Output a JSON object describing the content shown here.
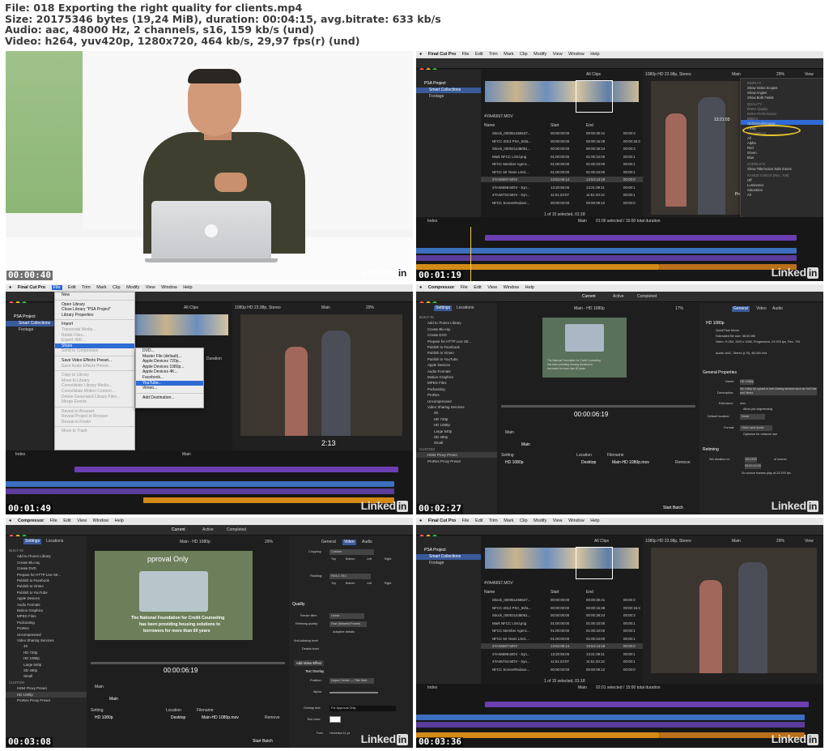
{
  "header": {
    "line1": "File: 018 Exporting the right quality for clients.mp4",
    "line2": "Size: 20175346 bytes (19,24 MiB), duration: 00:04:15, avg.bitrate: 633 kb/s",
    "line3": "Audio: aac, 48000 Hz, 2 channels, s16, 159 kb/s (und)",
    "line4": "Video: h264, yuv420p, 1280x720, 464 kb/s, 29,97 fps(r) (und)"
  },
  "watermark": "Linked",
  "watermark_in": "in",
  "thumbs": [
    {
      "timestamp": "00:00:40"
    },
    {
      "timestamp": "00:01:19"
    },
    {
      "timestamp": "00:01:49"
    },
    {
      "timestamp": "00:02:27"
    },
    {
      "timestamp": "00:03:08"
    },
    {
      "timestamp": "00:03:36"
    }
  ],
  "fcp": {
    "app": "Final Cut Pro",
    "menus": [
      "File",
      "Edit",
      "Trim",
      "Mark",
      "Clip",
      "Modify",
      "View",
      "Window",
      "Help"
    ],
    "library": "PSA Project",
    "smart_collections": "Smart Collections",
    "footage": "Footage",
    "all_clips": "All Clips",
    "format": "1080p HD 23.98p, Stereo",
    "zoom": "29%",
    "view_label": "View",
    "main": "Main",
    "clip_name": "4YA46697.MOV",
    "columns": [
      "Name",
      "Start",
      "End",
      "Duration"
    ],
    "rows": [
      [
        "iStock_000051456627...",
        "00:00:00:00",
        "00:00:30:41",
        "00:00:3"
      ],
      [
        "NFCC-2013 PSA_60/a...",
        "00:00:00:00",
        "00:00:15:38",
        "00:00:15:3"
      ],
      [
        "iStock_000021438051...",
        "00:00:00:00",
        "00:00:38:24",
        "00:00:3"
      ],
      [
        "Mark NFCC LSrd.png",
        "01:00:00:00",
        "01:00:10:00",
        "00:00:1"
      ],
      [
        "NFCC Member Agenc...",
        "01:00:00:00",
        "01:00:10:00",
        "00:00:1"
      ],
      [
        "NFCC 60 Years LSrd....",
        "01:00:00:00",
        "01:00:10:00",
        "00:00:1"
      ],
      [
        "4YA46697.MOV",
        "13:54:06:14",
        "13:54:13:18",
        "00:00:0"
      ],
      [
        "4YA46698.MOV - Syn...",
        "13:20:55:05",
        "13:21:08:11",
        "00:00:1"
      ],
      [
        "4YA46734.MOV - Syn...",
        "11:51:23:07",
        "11:51:33:12",
        "00:00:1"
      ],
      [
        "NFCC ScreenRedace...",
        "00:00:02:00",
        "00:00:09:12",
        "00:00:0"
      ]
    ],
    "selected_info": "1 of 15 selected, 01:18",
    "index": "Index",
    "timeline_info": "01:06 selected / 15:00 total duration",
    "timeline_info2": "02:01 selected / 15:00 total duration",
    "timecode": "2:13",
    "playhead_tc": "13:21:03",
    "proxy": "Proxy",
    "view_menu": {
      "display": "DISPLAY",
      "items": [
        "Show Video Scopes",
        "Show Angles",
        "Show Both Fields"
      ],
      "shortcuts": [
        "⌘7",
        "⇧⌘7",
        ""
      ],
      "quality": "QUALITY",
      "quality_items": [
        "Better Quality",
        "Better Performance"
      ],
      "media": "MEDIA",
      "optimized": "Optimized/Original",
      "proxy": "Proxy",
      "channels": "CHANNELS",
      "channel_items": [
        "All",
        "Alpha",
        "Red",
        "Green",
        "Blue"
      ],
      "overlays": "OVERLAYS",
      "safe_zones": "Show Title/Action Safe Zones",
      "range_check": "RANGE CHECK (Rec. 709)",
      "range_items": [
        "Off",
        "Luminance",
        "Saturation",
        "All"
      ]
    },
    "file_menu": [
      "New",
      "",
      "Open Library",
      "Close Library \"PSA Project\"",
      "Library Properties",
      "",
      "Import",
      "Transcode Media...",
      "Relink Files...",
      "Export XML...",
      "Share",
      "Send to Compressor",
      "",
      "Save Video Effects Preset...",
      "Save Audio Effects Preset...",
      "",
      "Copy to Library",
      "Move to Library",
      "Consolidate Library Media...",
      "Consolidate Motion Content...",
      "Delete Generated Library Files...",
      "Merge Events",
      "",
      "Reveal in Browser",
      "Reveal Project in Browser",
      "Reveal in Finder",
      "",
      "Move to Trash"
    ],
    "file_shortcuts": {
      "Library Properties": "^⌘J",
      "Reveal in Finder": "⇧⌘R",
      "Move to Trash": "⌘⌫"
    },
    "share_menu": [
      "DVD...",
      "Master File (default)...",
      "Apple Devices 720p...",
      "Apple Devices 1080p...",
      "Apple Devices 4K...",
      "Facebook...",
      "YouTube...",
      "Vimeo...",
      "",
      "Add Destination..."
    ],
    "share_shortcut": "⌘E"
  },
  "compressor": {
    "app": "Compressor",
    "menus": [
      "File",
      "Edit",
      "View",
      "Window",
      "Help"
    ],
    "tabs": [
      "Current",
      "Active",
      "Completed"
    ],
    "sidebar_tabs": [
      "Settings",
      "Locations"
    ],
    "viewer_title": "Main - HD 1080p",
    "zoom1": "17%",
    "zoom2": "29%",
    "builtin": "BUILT-IN",
    "settings_list": [
      "Add to iTunes Library",
      "Create Blu-ray",
      "Create DVD",
      "Prepare for HTTP Live Str...",
      "Publish to Facebook",
      "Publish to Vimeo",
      "Publish to YouTube",
      "Apple Devices",
      "Audio Formats",
      "Motion Graphics",
      "MPEG Files",
      "Podcasting",
      "ProRes",
      "Uncompressed",
      "Video Sharing Services"
    ],
    "sharing_sub": [
      "4K",
      "HD 720p",
      "HD 1080p",
      "Large 540p",
      "SD 480p",
      "Small"
    ],
    "custom": "CUSTOM",
    "custom_items_a": [
      "H264 Proxy Preset",
      "ProRes Proxy Preset"
    ],
    "custom_items_b": [
      "H264 Proxy Preset",
      "HD 1080p",
      "ProRes Proxy Preset"
    ],
    "tc": "00:00:06:19",
    "job": "Main",
    "job_cols": [
      "Setting",
      "Location",
      "Filename"
    ],
    "job_row": [
      "HD 1080p",
      "Desktop",
      "Main-HD 1080p.mov",
      "Remove"
    ],
    "start_batch": "Start Batch",
    "inspector_tabs": [
      "General",
      "Video",
      "Audio"
    ],
    "summary_title": "HD 1080p",
    "summary_lines": [
      "QuickTime Movie",
      "Estimated file size: 38.50 MB",
      "Video: H.264, 1920 x 1080, Progressive, 23.976 fps, Rec. 709",
      "Audio: AAC, Stereo (L R), 48.000 kHz"
    ],
    "general_properties": "General Properties",
    "name_label": "Name:",
    "name_value": "HD 1080p",
    "desc_label": "Description:",
    "desc_value": "HD 1080p for upload to web sharing services such as YouTube and Vimeo.",
    "ext_label": "Extension:",
    "ext_value": "mov",
    "allow_seg": "Allow job segmenting",
    "loc_label": "Default location:",
    "loc_value": "None",
    "format_label": "Format:",
    "format_value": "Video and Audio",
    "optimize": "Optimize for network use",
    "retiming": "Retiming",
    "set_duration": "Set duration to:",
    "pct": "100.00%",
    "of_source": "of source",
    "dur": "00:00:10:00",
    "so_source": "So source frames play at 23.976 fps",
    "cropping": "Cropping:",
    "cropping_val": "Custom",
    "padding": "Padding:",
    "padding_val": "Fit/4:1.78:1",
    "tblr": [
      "Top",
      "Bottom",
      "Left",
      "Right"
    ],
    "quality": "Quality",
    "resize_filter": "Resize filter:",
    "resize_val": "Linear",
    "retiming_quality": "Retiming quality:",
    "retiming_val": "Fast (Nearest Frame)",
    "adaptive": "Adaptive details",
    "anti_alias": "Anti-aliasing level:",
    "details": "Details level:",
    "add_effect": "Add Video Effect",
    "text_overlay": "Text Overlay",
    "position": "Position:",
    "position_val": "Upper Center — Title Safe",
    "alpha": "Alpha:",
    "overlay_text": "Overlay text:",
    "overlay_val": "For Approval Only",
    "text_color": "Text color:",
    "font": "Font:",
    "font_val": "Helvetica 11 pt",
    "approval": "pproval Only",
    "caption1": "The National Foundation for Credit Counseling",
    "caption2": "has been providing housing solutions to",
    "caption3": "borrowers for more than 60 years"
  }
}
